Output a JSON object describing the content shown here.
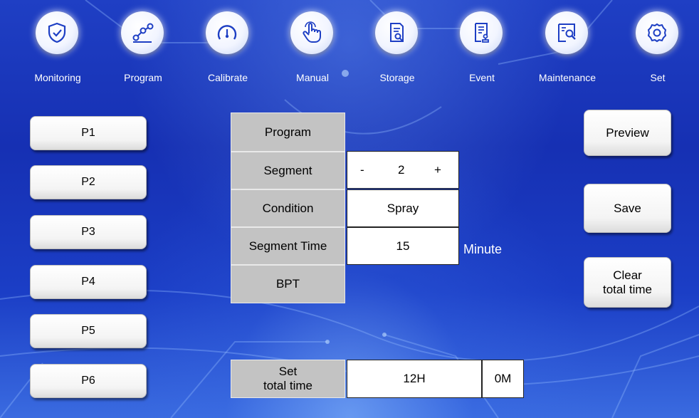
{
  "nav": [
    {
      "label": "Monitoring",
      "icon": "shield-check-icon"
    },
    {
      "label": "Program",
      "icon": "nodes-graph-icon"
    },
    {
      "label": "Calibrate",
      "icon": "gauge-icon"
    },
    {
      "label": "Manual",
      "icon": "hand-pointer-icon"
    },
    {
      "label": "Storage",
      "icon": "document-search-icon"
    },
    {
      "label": "Event",
      "icon": "document-stamp-icon"
    },
    {
      "label": "Maintenance",
      "icon": "inspection-icon"
    },
    {
      "label": "Set",
      "icon": "gear-icon"
    }
  ],
  "programs": [
    "P1",
    "P2",
    "P3",
    "P4",
    "P5",
    "P6"
  ],
  "form": {
    "program_label": "Program",
    "segment_label": "Segment",
    "segment_minus": "-",
    "segment_value": "2",
    "segment_plus": "+",
    "condition_label": "Condition",
    "condition_value": "Spray",
    "segment_time_label": "Segment Time",
    "segment_time_value": "15",
    "segment_time_unit": "Minute",
    "bpt_label": "BPT"
  },
  "total": {
    "label_line1": "Set",
    "label_line2": "total time",
    "hours": "12H",
    "minutes": "0M"
  },
  "actions": {
    "preview": "Preview",
    "save": "Save",
    "clear_line1": "Clear",
    "clear_line2": "total time"
  },
  "colors": {
    "background": "#1a36bb",
    "label_cell": "#c3c3c3",
    "icon_blue": "#1e3fc4"
  }
}
